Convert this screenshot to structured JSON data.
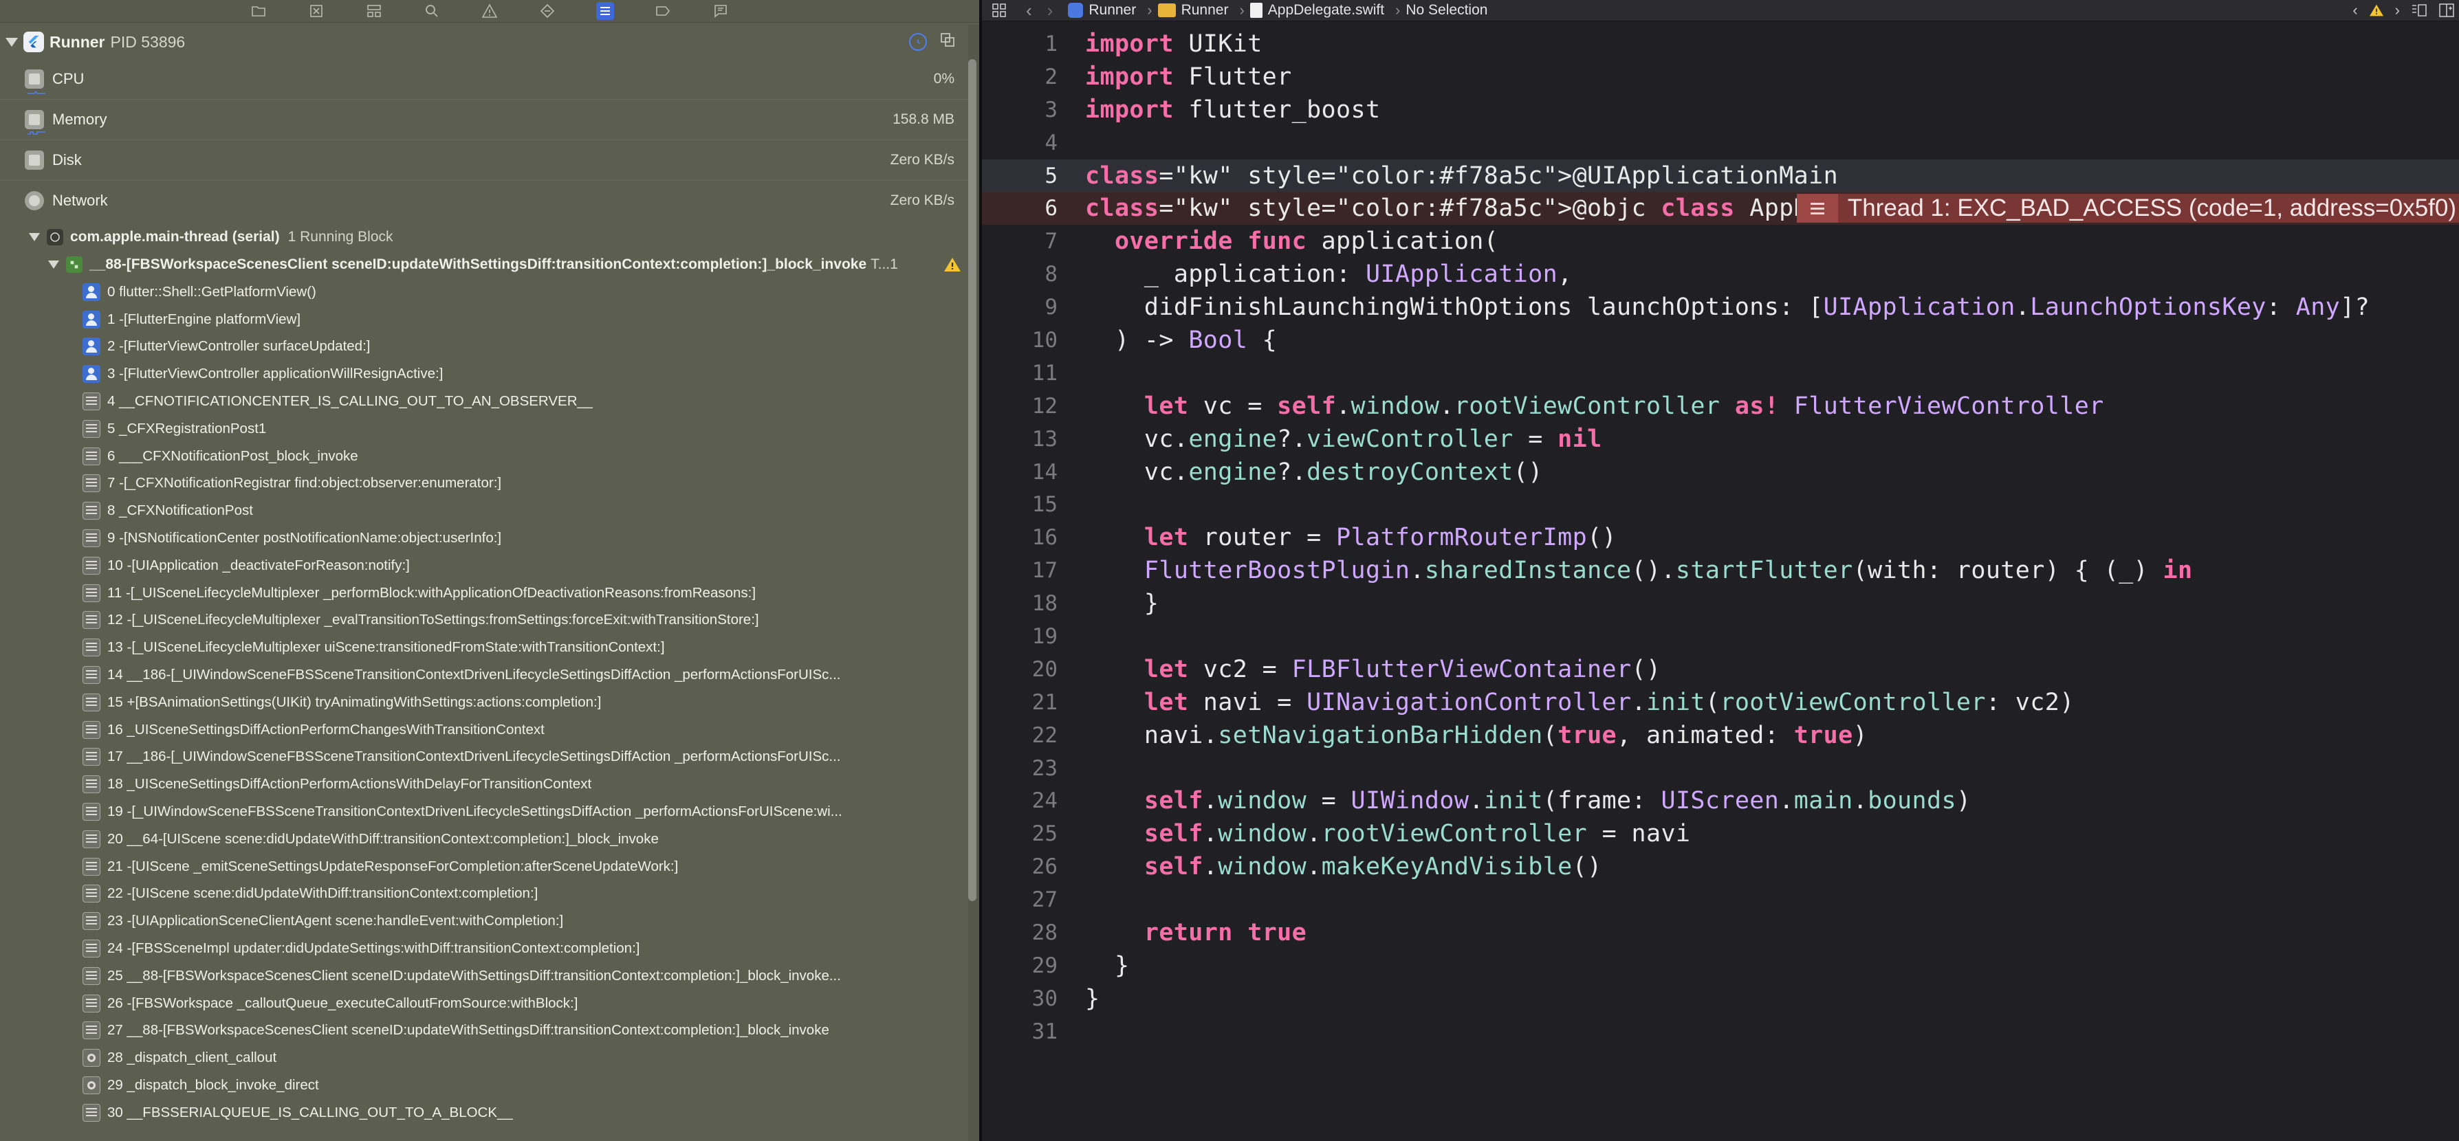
{
  "colors": {
    "navigator_bg": "#5c5e4f",
    "editor_bg": "#1f1f24",
    "error_line_bg": "#3a2627",
    "error_bubble": "#7a3535",
    "keyword": "#f66ea8",
    "type": "#d0a8ff",
    "accent_blue": "#3f69d8"
  },
  "navigator_toolbar": {
    "icons": [
      "folder-icon",
      "source-control-icon",
      "symbols-icon",
      "search-icon",
      "warning-icon",
      "test-icon",
      "debug-icon",
      "breakpoint-icon",
      "report-icon"
    ],
    "active": "debug-icon"
  },
  "process": {
    "name": "Runner",
    "pid": "PID 53896"
  },
  "gauges": [
    {
      "label": "CPU",
      "value": "0%",
      "icon": "cpu-icon"
    },
    {
      "label": "Memory",
      "value": "158.8 MB",
      "icon": "memory-icon"
    },
    {
      "label": "Disk",
      "value": "Zero KB/s",
      "icon": "disk-icon"
    },
    {
      "label": "Network",
      "value": "Zero KB/s",
      "icon": "network-icon"
    }
  ],
  "thread": {
    "name": "com.apple.main-thread (serial)",
    "status": "1 Running Block"
  },
  "block": {
    "name": "__88-[FBSWorkspaceScenesClient sceneID:updateWithSettingsDiff:transitionContext:completion:]_block_invoke",
    "suffix": "T...1"
  },
  "frames": [
    {
      "text": "0 flutter::Shell::GetPlatformView()",
      "icon": "user"
    },
    {
      "text": "1 -[FlutterEngine platformView]",
      "icon": "user"
    },
    {
      "text": "2 -[FlutterViewController surfaceUpdated:]",
      "icon": "user"
    },
    {
      "text": "3 -[FlutterViewController applicationWillResignActive:]",
      "icon": "user"
    },
    {
      "text": "4 __CFNOTIFICATIONCENTER_IS_CALLING_OUT_TO_AN_OBSERVER__",
      "icon": "lib"
    },
    {
      "text": "5 _CFXRegistrationPost1",
      "icon": "lib"
    },
    {
      "text": "6 ___CFXNotificationPost_block_invoke",
      "icon": "lib"
    },
    {
      "text": "7 -[_CFXNotificationRegistrar find:object:observer:enumerator:]",
      "icon": "lib"
    },
    {
      "text": "8 _CFXNotificationPost",
      "icon": "lib"
    },
    {
      "text": "9 -[NSNotificationCenter postNotificationName:object:userInfo:]",
      "icon": "lib"
    },
    {
      "text": "10 -[UIApplication _deactivateForReason:notify:]",
      "icon": "lib"
    },
    {
      "text": "11 -[_UISceneLifecycleMultiplexer _performBlock:withApplicationOfDeactivationReasons:fromReasons:]",
      "icon": "lib"
    },
    {
      "text": "12 -[_UISceneLifecycleMultiplexer _evalTransitionToSettings:fromSettings:forceExit:withTransitionStore:]",
      "icon": "lib"
    },
    {
      "text": "13 -[_UISceneLifecycleMultiplexer uiScene:transitionedFromState:withTransitionContext:]",
      "icon": "lib"
    },
    {
      "text": "14 __186-[_UIWindowSceneFBSSceneTransitionContextDrivenLifecycleSettingsDiffAction _performActionsForUISc...",
      "icon": "lib"
    },
    {
      "text": "15 +[BSAnimationSettings(UIKit) tryAnimatingWithSettings:actions:completion:]",
      "icon": "lib"
    },
    {
      "text": "16 _UISceneSettingsDiffActionPerformChangesWithTransitionContext",
      "icon": "lib"
    },
    {
      "text": "17 __186-[_UIWindowSceneFBSSceneTransitionContextDrivenLifecycleSettingsDiffAction _performActionsForUISc...",
      "icon": "lib"
    },
    {
      "text": "18 _UISceneSettingsDiffActionPerformActionsWithDelayForTransitionContext",
      "icon": "lib"
    },
    {
      "text": "19 -[_UIWindowSceneFBSSceneTransitionContextDrivenLifecycleSettingsDiffAction _performActionsForUIScene:wi...",
      "icon": "lib"
    },
    {
      "text": "20 __64-[UIScene scene:didUpdateWithDiff:transitionContext:completion:]_block_invoke",
      "icon": "lib"
    },
    {
      "text": "21 -[UIScene _emitSceneSettingsUpdateResponseForCompletion:afterSceneUpdateWork:]",
      "icon": "lib"
    },
    {
      "text": "22 -[UIScene scene:didUpdateWithDiff:transitionContext:completion:]",
      "icon": "lib"
    },
    {
      "text": "23 -[UIApplicationSceneClientAgent scene:handleEvent:withCompletion:]",
      "icon": "lib"
    },
    {
      "text": "24 -[FBSSceneImpl updater:didUpdateSettings:withDiff:transitionContext:completion:]",
      "icon": "lib"
    },
    {
      "text": "25 __88-[FBSWorkspaceScenesClient sceneID:updateWithSettingsDiff:transitionContext:completion:]_block_invoke...",
      "icon": "lib"
    },
    {
      "text": "26 -[FBSWorkspace _calloutQueue_executeCalloutFromSource:withBlock:]",
      "icon": "lib"
    },
    {
      "text": "27 __88-[FBSWorkspaceScenesClient sceneID:updateWithSettingsDiff:transitionContext:completion:]_block_invoke",
      "icon": "lib"
    },
    {
      "text": "28 _dispatch_client_callout",
      "icon": "gear"
    },
    {
      "text": "29 _dispatch_block_invoke_direct",
      "icon": "gear"
    },
    {
      "text": "30 __FBSSERIALQUEUE_IS_CALLING_OUT_TO_A_BLOCK__",
      "icon": "lib"
    }
  ],
  "jump_bar": {
    "items": [
      "Runner",
      "Runner",
      "AppDelegate.swift",
      "No Selection"
    ]
  },
  "editor": {
    "current_line": 5,
    "error_line": 6,
    "error_message": "Thread 1: EXC_BAD_ACCESS (code=1, address=0x5f0)",
    "lines": [
      "import UIKit",
      "import Flutter",
      "import flutter_boost",
      "",
      "@UIApplicationMain",
      "@objc class AppDelegate: FlutterAppDelegate {",
      "  override func application(",
      "    _ application: UIApplication,",
      "    didFinishLaunchingWithOptions launchOptions: [UIApplication.LaunchOptionsKey: Any]?",
      "  ) -> Bool {",
      "",
      "    let vc = self.window.rootViewController as! FlutterViewController",
      "    vc.engine?.viewController = nil",
      "    vc.engine?.destroyContext()",
      "",
      "    let router = PlatformRouterImp()",
      "    FlutterBoostPlugin.sharedInstance().startFlutter(with: router) { (_) in",
      "    }",
      "",
      "    let vc2 = FLBFlutterViewContainer()",
      "    let navi = UINavigationController.init(rootViewController: vc2)",
      "    navi.setNavigationBarHidden(true, animated: true)",
      "",
      "    self.window = UIWindow.init(frame: UIScreen.main.bounds)",
      "    self.window.rootViewController = navi",
      "    self.window.makeKeyAndVisible()",
      "",
      "    return true",
      "  }",
      "}",
      ""
    ]
  }
}
